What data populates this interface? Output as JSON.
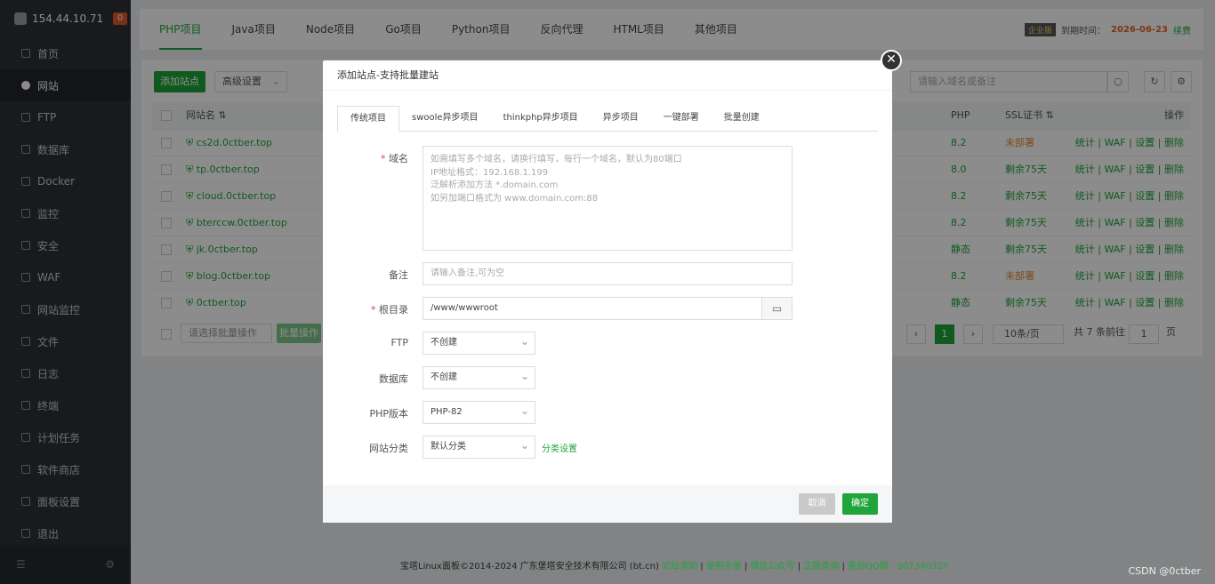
{
  "sidebar": {
    "ip": "154.44.10.71",
    "badge": "0",
    "items": [
      {
        "label": "首页",
        "icon": "home-icon"
      },
      {
        "label": "网站",
        "icon": "globe-icon"
      },
      {
        "label": "FTP",
        "icon": "ftp-icon"
      },
      {
        "label": "数据库",
        "icon": "database-icon"
      },
      {
        "label": "Docker",
        "icon": "docker-icon"
      },
      {
        "label": "监控",
        "icon": "monitor-icon"
      },
      {
        "label": "安全",
        "icon": "shield-icon"
      },
      {
        "label": "WAF",
        "icon": "waf-icon"
      },
      {
        "label": "网站监控",
        "icon": "chart-icon"
      },
      {
        "label": "文件",
        "icon": "folder-icon"
      },
      {
        "label": "日志",
        "icon": "log-icon"
      },
      {
        "label": "终端",
        "icon": "terminal-icon"
      },
      {
        "label": "计划任务",
        "icon": "calendar-icon"
      },
      {
        "label": "软件商店",
        "icon": "store-icon"
      },
      {
        "label": "面板设置",
        "icon": "gear-icon"
      },
      {
        "label": "退出",
        "icon": "logout-icon"
      }
    ]
  },
  "topbar": {
    "tabs": [
      "PHP项目",
      "Java项目",
      "Node项目",
      "Go项目",
      "Python项目",
      "反向代理",
      "HTML项目",
      "其他项目"
    ],
    "edition": "企业版",
    "expire_label": "到期时间：",
    "expire_date": "2026-06-23",
    "renew": "续费"
  },
  "toolbar": {
    "add_site": "添加站点",
    "advanced": "高级设置",
    "search_placeholder": "请输入域名或备注"
  },
  "table": {
    "headers": {
      "name": "网站名 ⇅",
      "php": "PHP",
      "ssl": "SSL证书 ⇅",
      "ops": "操作"
    },
    "rows": [
      {
        "name": "cs2d.0ctber.top",
        "php": "8.2",
        "ssl": "未部署",
        "ssl_state": "orange"
      },
      {
        "name": "tp.0ctber.top",
        "php": "8.0",
        "ssl": "剩余75天",
        "ssl_state": "green"
      },
      {
        "name": "cloud.0ctber.top",
        "php": "8.2",
        "ssl": "剩余75天",
        "ssl_state": "green"
      },
      {
        "name": "bterccw.0ctber.top",
        "php": "8.2",
        "ssl": "剩余75天",
        "ssl_state": "green"
      },
      {
        "name": "jk.0ctber.top",
        "php": "静态",
        "ssl": "剩余75天",
        "ssl_state": "green"
      },
      {
        "name": "blog.0ctber.top",
        "php": "8.2",
        "ssl": "未部署",
        "ssl_state": "orange"
      },
      {
        "name": "0ctber.top",
        "php": "静态",
        "ssl": "剩余75天",
        "ssl_state": "green"
      }
    ],
    "ops": "统计 | WAF | 设置 | 删除"
  },
  "footer_bar": {
    "batch_select": "请选择批量操作",
    "batch_btn": "批量操作",
    "page": "1",
    "per_page": "10条/页",
    "total": "共 7 条",
    "goto_label": "前往",
    "goto_value": "1",
    "page_unit": "页"
  },
  "page_footer": {
    "copyright": "宝塔Linux面板©2014-2024 广东堡塔安全技术有限公司 (bt.cn)",
    "links": [
      "论坛求助",
      "使用手册",
      "微信公众号",
      "正版查询"
    ],
    "qq": "售后QQ群：907340327"
  },
  "watermark": "CSDN @0ctber",
  "modal": {
    "title": "添加站点-支持批量建站",
    "tabs": [
      "传统项目",
      "swoole异步项目",
      "thinkphp异步项目",
      "异步项目",
      "一键部署",
      "批量创建"
    ],
    "domain_label": "域名",
    "domain_placeholder_lines": [
      "如需填写多个域名，请换行填写，每行一个域名，默认为80端口",
      "IP地址格式：192.168.1.199",
      "泛解析添加方法 *.domain.com",
      "如另加端口格式为 www.domain.com:88"
    ],
    "note_label": "备注",
    "note_placeholder": "请输入备注,可为空",
    "root_label": "根目录",
    "root_value": "/www/wwwroot",
    "ftp_label": "FTP",
    "ftp_value": "不创建",
    "db_label": "数据库",
    "db_value": "不创建",
    "php_label": "PHP版本",
    "php_value": "PHP-82",
    "category_label": "网站分类",
    "category_value": "默认分类",
    "category_link": "分类设置",
    "cancel": "取消",
    "ok": "确定"
  }
}
